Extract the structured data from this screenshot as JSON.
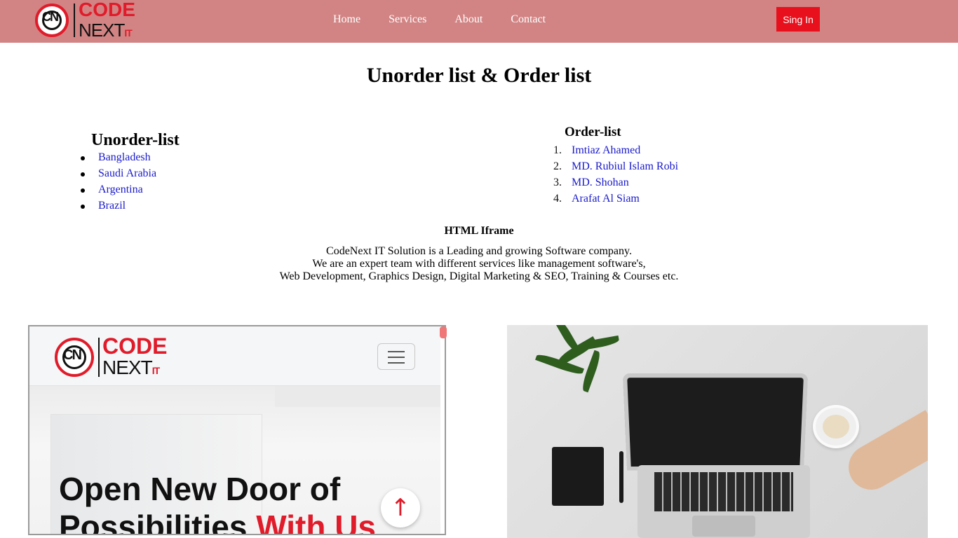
{
  "navbar": {
    "logo": {
      "code": "CODE",
      "next": "NEXT",
      "it": "IT",
      "mark": "CN"
    },
    "links": [
      "Home",
      "Services",
      "About",
      "Contact"
    ],
    "signin_label": "Sing In"
  },
  "page_title": "Unorder list & Order list",
  "unordered": {
    "title": "Unorder-list",
    "items": [
      "Bangladesh",
      "Saudi Arabia",
      "Argentina",
      "Brazil"
    ]
  },
  "ordered": {
    "title": "Order-list",
    "items": [
      "Imtiaz Ahamed",
      "MD. Rubiul Islam Robi",
      "MD. Shohan",
      "Arafat Al Siam"
    ]
  },
  "iframe_section": {
    "title": "HTML Iframe",
    "description": [
      "CodeNext IT Solution is a Leading and growing Software company.",
      "We are an expert team with different services like management software's,",
      "Web Development, Graphics Design, Digital Marketing & SEO, Training & Courses etc."
    ]
  },
  "iframe": {
    "logo": {
      "code": "CODE",
      "next": "NEXT",
      "it": "IT",
      "mark": "CN"
    },
    "hero_line1": "Open New Door of",
    "hero_line2_start": "Possibilities",
    "hero_line2_accent": "With Us"
  },
  "icons": {
    "scroll_top": "arrow-up-icon",
    "menu": "hamburger-icon"
  },
  "colors": {
    "navbar_bg": "#d28484",
    "signin_bg": "#e8101c",
    "link": "#1a1acc",
    "brand_red": "#e01b2a"
  }
}
